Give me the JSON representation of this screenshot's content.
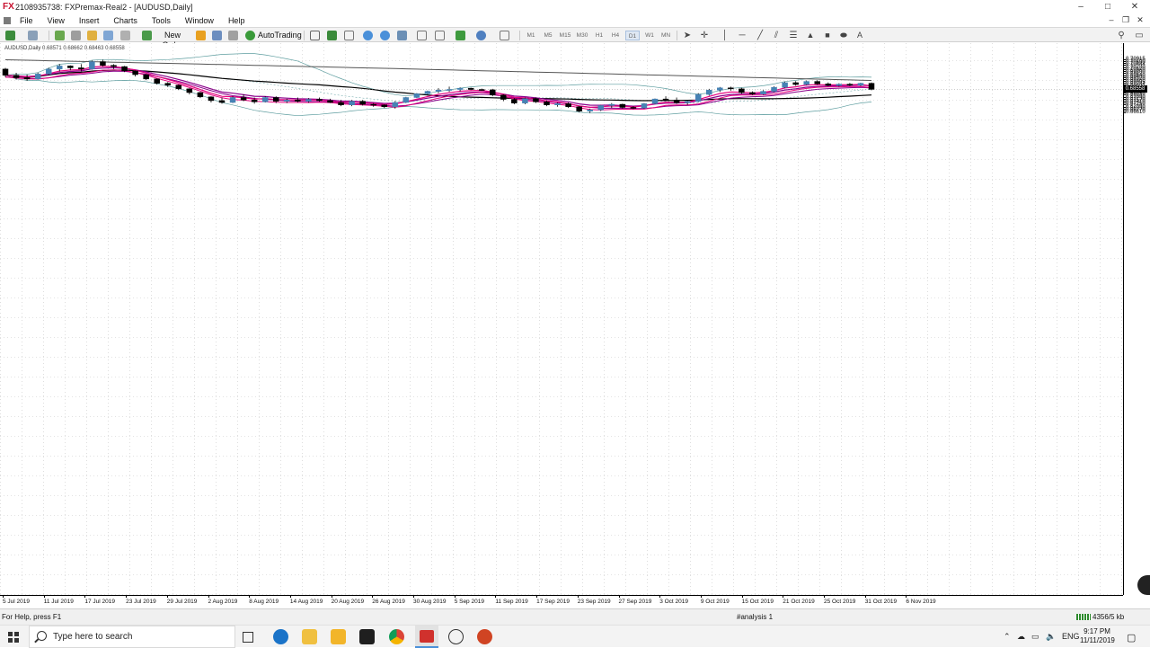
{
  "window": {
    "logo": "FX",
    "title": "2108935738: FXPremax-Real2 - [AUDUSD,Daily]",
    "controls": [
      "–",
      "□",
      "✕"
    ],
    "mdi_controls": [
      "–",
      "❐",
      "✕"
    ]
  },
  "menu": {
    "items": [
      "File",
      "View",
      "Insert",
      "Charts",
      "Tools",
      "Window",
      "Help"
    ]
  },
  "toolbar": {
    "new_order": "New Order",
    "auto_trading": "AutoTrading",
    "timeframes": [
      "M1",
      "M5",
      "M15",
      "M30",
      "H1",
      "H4",
      "D1",
      "W1",
      "MN"
    ],
    "text_tool": "A"
  },
  "chart": {
    "symbol_label": "AUDUSD,Daily",
    "ohlc_label": "0.68571 0.68662 0.68463 0.68558",
    "current_price": "0.68558",
    "price_ticks": [
      "0.70915",
      "0.70760",
      "0.70600",
      "0.70444",
      "0.70280",
      "0.70120",
      "0.69960",
      "0.69800",
      "0.69640",
      "0.69480",
      "0.69320",
      "0.69160",
      "0.69005",
      "0.68844",
      "0.68685",
      "0.68525",
      "0.68365",
      "0.68210",
      "0.68050",
      "0.67890",
      "0.67730",
      "0.67570",
      "0.67410",
      "0.67250",
      "0.67090",
      "0.66930",
      "0.66770",
      "0.66610"
    ],
    "date_ticks": [
      "5 Jul 2019",
      "11 Jul 2019",
      "17 Jul 2019",
      "23 Jul 2019",
      "29 Jul 2019",
      "2 Aug 2019",
      "8 Aug 2019",
      "14 Aug 2019",
      "20 Aug 2019",
      "26 Aug 2019",
      "30 Aug 2019",
      "5 Sep 2019",
      "11 Sep 2019",
      "17 Sep 2019",
      "23 Sep 2019",
      "27 Sep 2019",
      "3 Oct 2019",
      "9 Oct 2019",
      "15 Oct 2019",
      "21 Oct 2019",
      "25 Oct 2019",
      "31 Oct 2019",
      "6 Nov 2019"
    ],
    "colors": {
      "bull": "#4682b4",
      "bear": "#000000",
      "ema_fast": "#e6007e",
      "ema_slow": "#8b008b",
      "ma_long": "#000000",
      "ma_200": "#555555",
      "bands": "#5f9ea0",
      "grid": "#c8c8c8"
    }
  },
  "chart_data": {
    "type": "candlestick",
    "symbol": "AUDUSD",
    "timeframe": "Daily",
    "candles": [
      {
        "o": 0.702,
        "h": 0.703,
        "l": 0.6955,
        "c": 0.697
      },
      {
        "o": 0.697,
        "h": 0.699,
        "l": 0.6935,
        "c": 0.695
      },
      {
        "o": 0.695,
        "h": 0.6975,
        "l": 0.6925,
        "c": 0.694
      },
      {
        "o": 0.694,
        "h": 0.699,
        "l": 0.6935,
        "c": 0.698
      },
      {
        "o": 0.698,
        "h": 0.703,
        "l": 0.697,
        "c": 0.702
      },
      {
        "o": 0.702,
        "h": 0.706,
        "l": 0.7,
        "c": 0.7045
      },
      {
        "o": 0.7045,
        "h": 0.705,
        "l": 0.701,
        "c": 0.703
      },
      {
        "o": 0.703,
        "h": 0.706,
        "l": 0.7,
        "c": 0.702
      },
      {
        "o": 0.702,
        "h": 0.709,
        "l": 0.7015,
        "c": 0.708
      },
      {
        "o": 0.708,
        "h": 0.7095,
        "l": 0.704,
        "c": 0.705
      },
      {
        "o": 0.705,
        "h": 0.706,
        "l": 0.702,
        "c": 0.704
      },
      {
        "o": 0.704,
        "h": 0.7045,
        "l": 0.6995,
        "c": 0.7005
      },
      {
        "o": 0.7005,
        "h": 0.701,
        "l": 0.696,
        "c": 0.6975
      },
      {
        "o": 0.6975,
        "h": 0.698,
        "l": 0.693,
        "c": 0.694
      },
      {
        "o": 0.694,
        "h": 0.6945,
        "l": 0.6895,
        "c": 0.6905
      },
      {
        "o": 0.6905,
        "h": 0.6915,
        "l": 0.6875,
        "c": 0.689
      },
      {
        "o": 0.689,
        "h": 0.6895,
        "l": 0.685,
        "c": 0.686
      },
      {
        "o": 0.686,
        "h": 0.6865,
        "l": 0.6815,
        "c": 0.683
      },
      {
        "o": 0.683,
        "h": 0.6835,
        "l": 0.6785,
        "c": 0.6795
      },
      {
        "o": 0.6795,
        "h": 0.68,
        "l": 0.675,
        "c": 0.6765
      },
      {
        "o": 0.6765,
        "h": 0.679,
        "l": 0.674,
        "c": 0.675
      },
      {
        "o": 0.675,
        "h": 0.68,
        "l": 0.6745,
        "c": 0.679
      },
      {
        "o": 0.679,
        "h": 0.6815,
        "l": 0.676,
        "c": 0.677
      },
      {
        "o": 0.677,
        "h": 0.679,
        "l": 0.674,
        "c": 0.6755
      },
      {
        "o": 0.6755,
        "h": 0.68,
        "l": 0.675,
        "c": 0.679
      },
      {
        "o": 0.679,
        "h": 0.68,
        "l": 0.6745,
        "c": 0.676
      },
      {
        "o": 0.676,
        "h": 0.678,
        "l": 0.6745,
        "c": 0.677
      },
      {
        "o": 0.677,
        "h": 0.679,
        "l": 0.675,
        "c": 0.676
      },
      {
        "o": 0.676,
        "h": 0.6785,
        "l": 0.6748,
        "c": 0.6775
      },
      {
        "o": 0.6775,
        "h": 0.679,
        "l": 0.6755,
        "c": 0.6765
      },
      {
        "o": 0.6765,
        "h": 0.678,
        "l": 0.6745,
        "c": 0.675
      },
      {
        "o": 0.675,
        "h": 0.677,
        "l": 0.672,
        "c": 0.673
      },
      {
        "o": 0.673,
        "h": 0.677,
        "l": 0.672,
        "c": 0.676
      },
      {
        "o": 0.676,
        "h": 0.677,
        "l": 0.6725,
        "c": 0.6735
      },
      {
        "o": 0.6735,
        "h": 0.6745,
        "l": 0.6715,
        "c": 0.673
      },
      {
        "o": 0.673,
        "h": 0.6735,
        "l": 0.6705,
        "c": 0.6715
      },
      {
        "o": 0.6715,
        "h": 0.676,
        "l": 0.67,
        "c": 0.675
      },
      {
        "o": 0.675,
        "h": 0.6795,
        "l": 0.6745,
        "c": 0.679
      },
      {
        "o": 0.679,
        "h": 0.6825,
        "l": 0.6785,
        "c": 0.682
      },
      {
        "o": 0.682,
        "h": 0.6845,
        "l": 0.6805,
        "c": 0.684
      },
      {
        "o": 0.684,
        "h": 0.6865,
        "l": 0.6825,
        "c": 0.685
      },
      {
        "o": 0.685,
        "h": 0.6878,
        "l": 0.6835,
        "c": 0.6855
      },
      {
        "o": 0.6855,
        "h": 0.6872,
        "l": 0.6838,
        "c": 0.6865
      },
      {
        "o": 0.6865,
        "h": 0.687,
        "l": 0.685,
        "c": 0.6855
      },
      {
        "o": 0.6855,
        "h": 0.6862,
        "l": 0.6845,
        "c": 0.6852
      },
      {
        "o": 0.6852,
        "h": 0.686,
        "l": 0.68,
        "c": 0.681
      },
      {
        "o": 0.681,
        "h": 0.6815,
        "l": 0.676,
        "c": 0.6775
      },
      {
        "o": 0.6775,
        "h": 0.6785,
        "l": 0.6735,
        "c": 0.6745
      },
      {
        "o": 0.6745,
        "h": 0.679,
        "l": 0.6735,
        "c": 0.678
      },
      {
        "o": 0.678,
        "h": 0.679,
        "l": 0.6745,
        "c": 0.6755
      },
      {
        "o": 0.6755,
        "h": 0.6765,
        "l": 0.672,
        "c": 0.673
      },
      {
        "o": 0.673,
        "h": 0.675,
        "l": 0.6715,
        "c": 0.674
      },
      {
        "o": 0.674,
        "h": 0.675,
        "l": 0.6705,
        "c": 0.6715
      },
      {
        "o": 0.6715,
        "h": 0.672,
        "l": 0.667,
        "c": 0.668
      },
      {
        "o": 0.668,
        "h": 0.67,
        "l": 0.6665,
        "c": 0.669
      },
      {
        "o": 0.669,
        "h": 0.673,
        "l": 0.668,
        "c": 0.6725
      },
      {
        "o": 0.6725,
        "h": 0.6745,
        "l": 0.6705,
        "c": 0.6735
      },
      {
        "o": 0.6735,
        "h": 0.674,
        "l": 0.67,
        "c": 0.671
      },
      {
        "o": 0.671,
        "h": 0.672,
        "l": 0.6695,
        "c": 0.6705
      },
      {
        "o": 0.6705,
        "h": 0.6745,
        "l": 0.6698,
        "c": 0.674
      },
      {
        "o": 0.674,
        "h": 0.6782,
        "l": 0.6735,
        "c": 0.6778
      },
      {
        "o": 0.6778,
        "h": 0.68,
        "l": 0.676,
        "c": 0.677
      },
      {
        "o": 0.677,
        "h": 0.679,
        "l": 0.6738,
        "c": 0.6748
      },
      {
        "o": 0.6748,
        "h": 0.6765,
        "l": 0.673,
        "c": 0.6758
      },
      {
        "o": 0.6758,
        "h": 0.6825,
        "l": 0.6752,
        "c": 0.6815
      },
      {
        "o": 0.6815,
        "h": 0.686,
        "l": 0.6805,
        "c": 0.685
      },
      {
        "o": 0.685,
        "h": 0.6875,
        "l": 0.6835,
        "c": 0.6868
      },
      {
        "o": 0.6868,
        "h": 0.6878,
        "l": 0.6845,
        "c": 0.686
      },
      {
        "o": 0.686,
        "h": 0.6868,
        "l": 0.682,
        "c": 0.683
      },
      {
        "o": 0.683,
        "h": 0.684,
        "l": 0.681,
        "c": 0.6818
      },
      {
        "o": 0.6818,
        "h": 0.685,
        "l": 0.6812,
        "c": 0.684
      },
      {
        "o": 0.684,
        "h": 0.688,
        "l": 0.6832,
        "c": 0.6872
      },
      {
        "o": 0.6872,
        "h": 0.6918,
        "l": 0.6865,
        "c": 0.691
      },
      {
        "o": 0.691,
        "h": 0.6922,
        "l": 0.6885,
        "c": 0.6895
      },
      {
        "o": 0.6895,
        "h": 0.6928,
        "l": 0.6888,
        "c": 0.692
      },
      {
        "o": 0.692,
        "h": 0.693,
        "l": 0.6892,
        "c": 0.69
      },
      {
        "o": 0.69,
        "h": 0.6912,
        "l": 0.688,
        "c": 0.6888
      },
      {
        "o": 0.6888,
        "h": 0.6905,
        "l": 0.6878,
        "c": 0.6898
      },
      {
        "o": 0.6898,
        "h": 0.6908,
        "l": 0.6882,
        "c": 0.689
      },
      {
        "o": 0.689,
        "h": 0.691,
        "l": 0.6882,
        "c": 0.6905
      },
      {
        "o": 0.6905,
        "h": 0.6912,
        "l": 0.6848,
        "c": 0.6856
      }
    ],
    "indicators": [
      "EMA fast",
      "EMA slow",
      "MA",
      "MA 200",
      "Bollinger Bands"
    ]
  },
  "status": {
    "help_text": "For Help, press F1",
    "profile": "#analysis 1",
    "traffic": "4356/5 kb"
  },
  "taskbar": {
    "search_placeholder": "Type here to search",
    "language": "ENG",
    "time": "9:17 PM",
    "date": "11/11/2019"
  }
}
